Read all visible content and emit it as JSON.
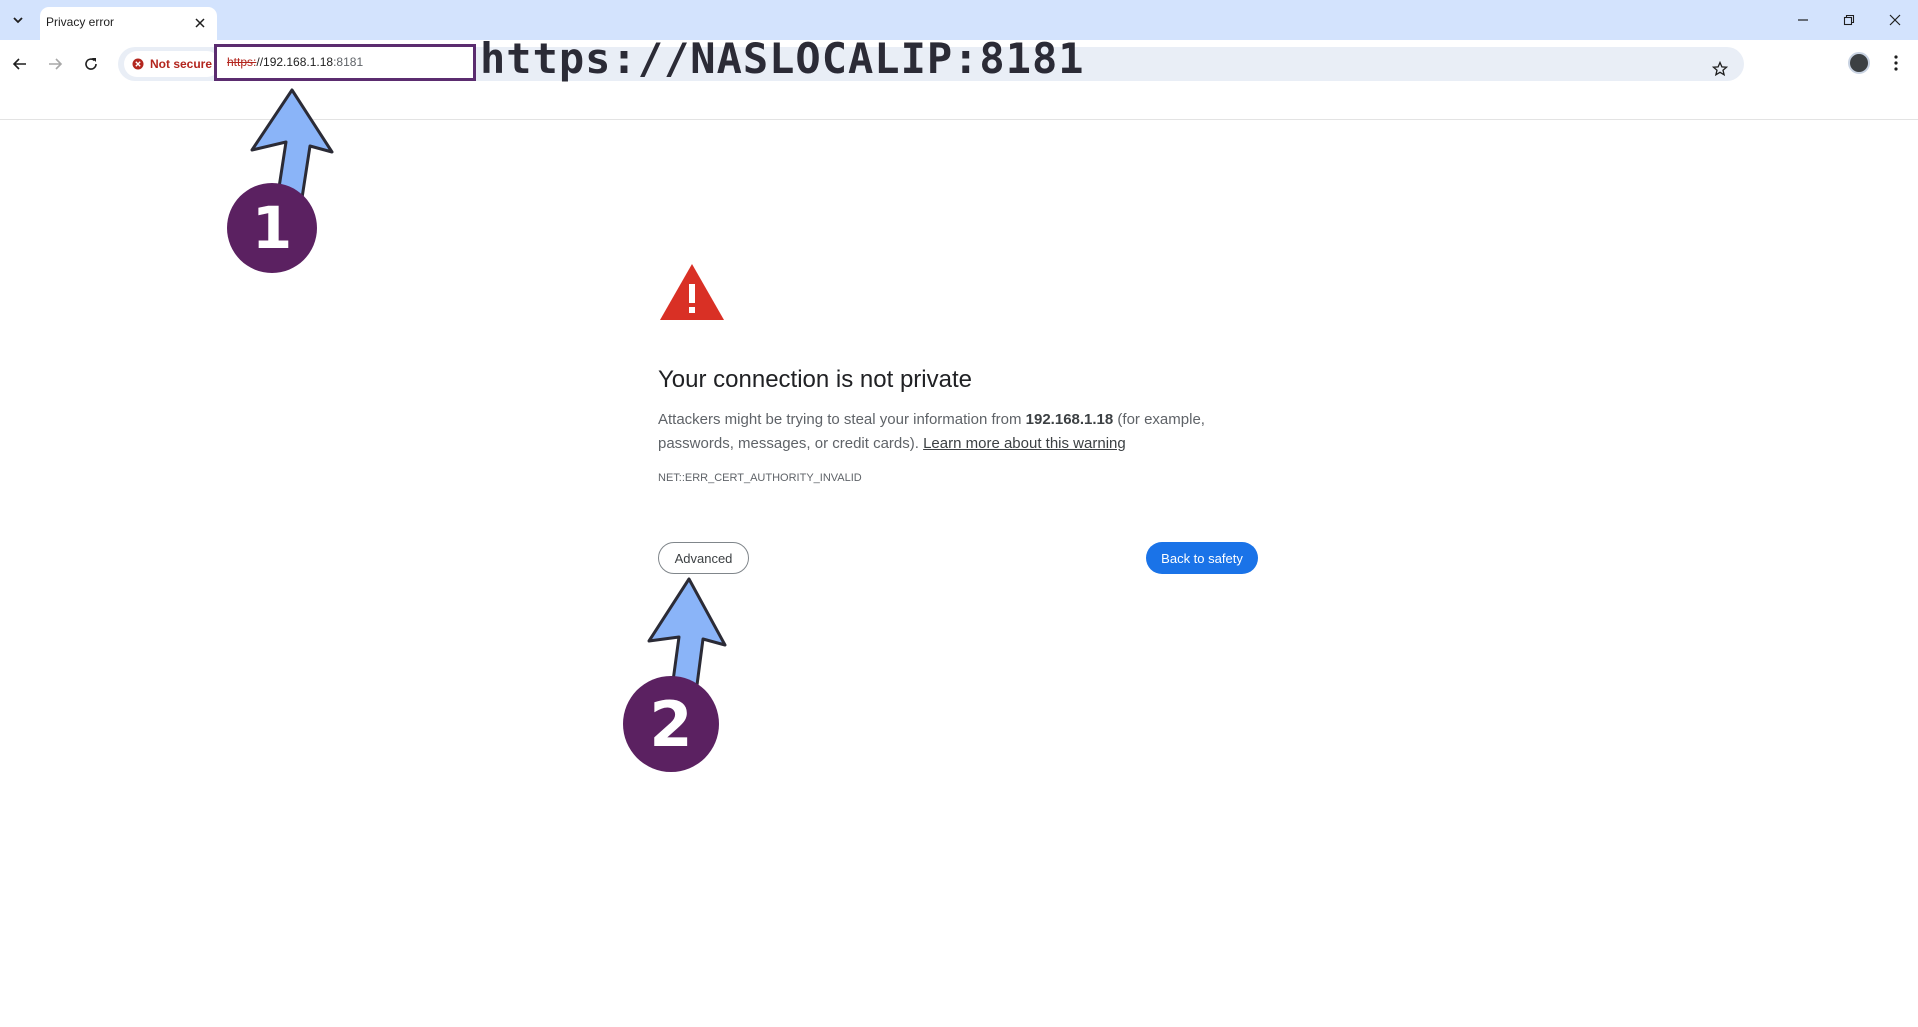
{
  "browser": {
    "tab": {
      "title": "Privacy error"
    },
    "address_bar": {
      "security_label": "Not secure",
      "url_scheme": "https:",
      "url_host": "//192.168.1.18",
      "url_port": ":8181"
    }
  },
  "overlay": {
    "url_caption": "https://NASLOCALIP:8181",
    "step_1": "1",
    "step_2": "2",
    "step_color": "#5b2161",
    "arrow_color": "#8ab4f8"
  },
  "interstitial": {
    "heading": "Your connection is not private",
    "body_prefix": "Attackers might be trying to steal your information from ",
    "body_host": "192.168.1.18",
    "body_suffix": " (for example, passwords, messages, or credit cards). ",
    "learn_more": "Learn more about this warning",
    "error_code": "NET::ERR_CERT_AUTHORITY_INVALID",
    "advanced_label": "Advanced",
    "back_label": "Back to safety",
    "warning_color": "#d93025",
    "primary_color": "#1a73e8"
  }
}
